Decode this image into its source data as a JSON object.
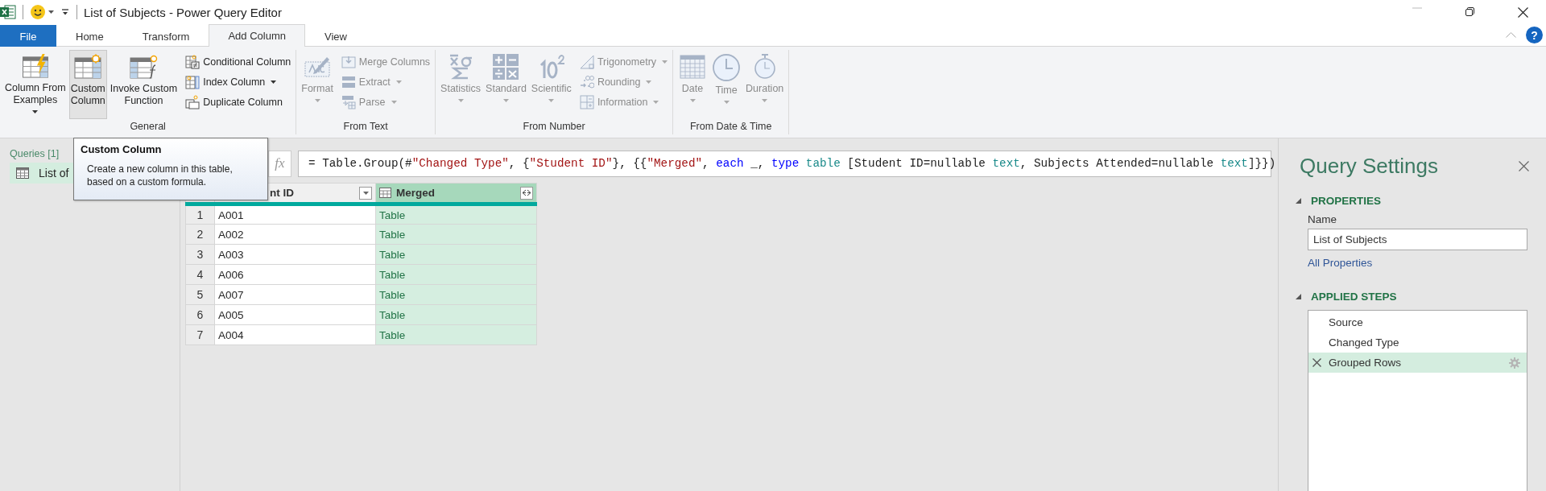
{
  "title_bar": {
    "title": "List of Subjects - Power Query Editor"
  },
  "tabs": [
    {
      "label": "File",
      "kind": "file",
      "selected": false
    },
    {
      "label": "Home",
      "kind": "tab",
      "selected": false
    },
    {
      "label": "Transform",
      "kind": "tab",
      "selected": false
    },
    {
      "label": "Add Column",
      "kind": "tab",
      "selected": true
    },
    {
      "label": "View",
      "kind": "tab",
      "selected": false
    }
  ],
  "help": {
    "label": "?"
  },
  "ribbon": {
    "groups": [
      {
        "label": "General",
        "large": [
          {
            "lines": [
              "Column From",
              "Examples"
            ],
            "dropdown": true,
            "disabled": false,
            "highlighted": false
          },
          {
            "lines": [
              "Custom",
              "Column"
            ],
            "dropdown": false,
            "disabled": false,
            "highlighted": true
          },
          {
            "lines": [
              "Invoke Custom",
              "Function"
            ],
            "dropdown": false,
            "disabled": false,
            "highlighted": false
          }
        ],
        "small": [
          {
            "label": "Conditional Column",
            "dropdown": false,
            "disabled": false
          },
          {
            "label": "Index Column",
            "dropdown": true,
            "disabled": false
          },
          {
            "label": "Duplicate Column",
            "dropdown": false,
            "disabled": false
          }
        ]
      },
      {
        "label": "From Text",
        "large": [
          {
            "lines": [
              "Format"
            ],
            "dropdown": true,
            "disabled": true,
            "highlighted": false
          }
        ],
        "small": [
          {
            "label": "Merge Columns",
            "dropdown": false,
            "disabled": true
          },
          {
            "label": "Extract",
            "dropdown": true,
            "disabled": true
          },
          {
            "label": "Parse",
            "dropdown": true,
            "disabled": true
          }
        ]
      },
      {
        "label": "From Number",
        "large": [
          {
            "lines": [
              "Statistics"
            ],
            "dropdown": true,
            "disabled": true,
            "highlighted": false
          },
          {
            "lines": [
              "Standard"
            ],
            "dropdown": true,
            "disabled": true,
            "highlighted": false
          },
          {
            "lines": [
              "Scientific"
            ],
            "dropdown": true,
            "disabled": true,
            "highlighted": false
          }
        ],
        "small": [
          {
            "label": "Trigonometry",
            "dropdown": true,
            "disabled": true
          },
          {
            "label": "Rounding",
            "dropdown": true,
            "disabled": true
          },
          {
            "label": "Information",
            "dropdown": true,
            "disabled": true
          }
        ]
      },
      {
        "label": "From Date & Time",
        "large": [
          {
            "lines": [
              "Date"
            ],
            "dropdown": true,
            "disabled": true,
            "highlighted": false
          },
          {
            "lines": [
              "Time"
            ],
            "dropdown": true,
            "disabled": true,
            "highlighted": false
          },
          {
            "lines": [
              "Duration"
            ],
            "dropdown": true,
            "disabled": true,
            "highlighted": false
          }
        ]
      }
    ]
  },
  "queries": {
    "title": "Queries [1]",
    "items": [
      {
        "label": "List of",
        "selected": true
      }
    ]
  },
  "tooltip": {
    "title": "Custom Column",
    "lines": [
      "Create a new column in this table,",
      "based on a custom formula."
    ]
  },
  "formula_bar": {
    "fx": "fx",
    "tokens": [
      {
        "text": "= Table.Group(#",
        "kind": "plain"
      },
      {
        "text": "\"Changed Type\"",
        "kind": "string"
      },
      {
        "text": ", {",
        "kind": "plain"
      },
      {
        "text": "\"Student ID\"",
        "kind": "string"
      },
      {
        "text": "}, {{",
        "kind": "plain"
      },
      {
        "text": "\"Merged\"",
        "kind": "string"
      },
      {
        "text": ",",
        "kind": "plain"
      },
      {
        "text": "each",
        "kind": "keyword",
        "space_before": true
      },
      {
        "text": "_,",
        "kind": "plain",
        "space_before": true
      },
      {
        "text": "type",
        "kind": "keyword",
        "space_before": true
      },
      {
        "text": "table",
        "kind": "type",
        "space_before": true
      },
      {
        "text": "[Student ID=nullable",
        "kind": "plain",
        "space_before": true
      },
      {
        "text": "text",
        "kind": "type",
        "space_before": true
      },
      {
        "text": ", Subjects Attended=nullable",
        "kind": "plain"
      },
      {
        "text": "text",
        "kind": "type",
        "space_before": true
      },
      {
        "text": "]}})",
        "kind": "plain"
      }
    ]
  },
  "table": {
    "columns": [
      {
        "label": "nt ID",
        "kind": "text",
        "selected": false
      },
      {
        "label": "Merged",
        "kind": "table",
        "selected": true
      }
    ],
    "rows": [
      {
        "number": "1",
        "cells": [
          "A001",
          "Table"
        ]
      },
      {
        "number": "2",
        "cells": [
          "A002",
          "Table"
        ]
      },
      {
        "number": "3",
        "cells": [
          "A003",
          "Table"
        ]
      },
      {
        "number": "4",
        "cells": [
          "A006",
          "Table"
        ]
      },
      {
        "number": "5",
        "cells": [
          "A007",
          "Table"
        ]
      },
      {
        "number": "6",
        "cells": [
          "A005",
          "Table"
        ]
      },
      {
        "number": "7",
        "cells": [
          "A004",
          "Table"
        ]
      }
    ]
  },
  "query_settings": {
    "title": "Query Settings",
    "properties": {
      "heading": "PROPERTIES",
      "name_label": "Name",
      "name_value": "List of Subjects",
      "link": "All Properties"
    },
    "applied_steps": {
      "heading": "APPLIED STEPS",
      "steps": [
        {
          "label": "Source",
          "selected": false
        },
        {
          "label": "Changed Type",
          "selected": false
        },
        {
          "label": "Grouped Rows",
          "selected": true
        }
      ]
    }
  }
}
